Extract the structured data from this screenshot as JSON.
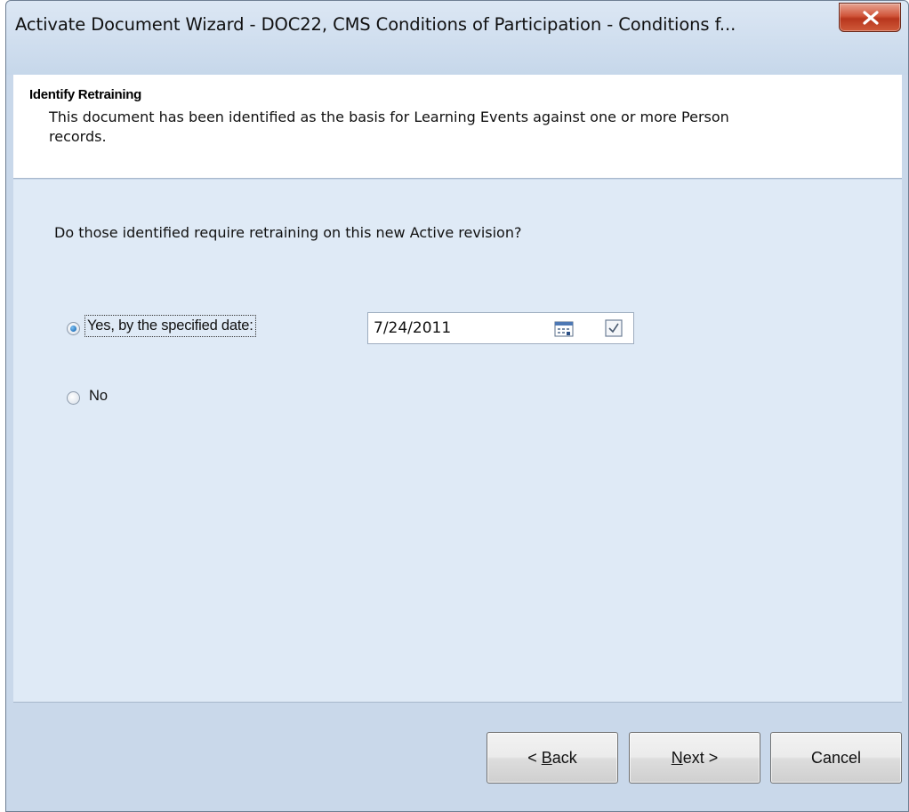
{
  "window": {
    "title": "Activate Document Wizard - DOC22, CMS Conditions of Participation - Conditions f..."
  },
  "header": {
    "title": "Identify Retraining",
    "description": "This document has been identified as the basis for Learning Events against one or more Person records."
  },
  "body": {
    "question": "Do those identified require retraining on this new Active revision?",
    "options": [
      {
        "label": "Yes, by the specified date:",
        "selected": true
      },
      {
        "label": "No",
        "selected": false
      }
    ],
    "date_value": "7/24/2011"
  },
  "buttons": {
    "back": {
      "accel": "B",
      "rest": "ack",
      "prefix": "< "
    },
    "next": {
      "accel": "N",
      "rest": "ext >"
    },
    "cancel": "Cancel"
  },
  "colors": {
    "background": "#dfeaf6",
    "header_background": "#ffffff",
    "close_button": "#c7442b"
  },
  "icons": {
    "close": "close-icon",
    "calendar": "calendar-icon",
    "checkbox": "checkbox-icon"
  }
}
